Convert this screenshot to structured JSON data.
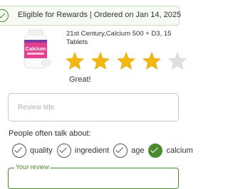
{
  "banner": {
    "text": "Eligible for Rewards | Ordered on Jan 14, 2025",
    "icon": "check-circle-icon",
    "accent_color": "#4a8a2e"
  },
  "product": {
    "name_line1": "21st Century,Calcium 500 + D3, 15 mcg (600",
    "name_line2": "Tablets",
    "label_text": "Calcium"
  },
  "rating": {
    "stars": 4,
    "label": "Great!",
    "star_color": "#f5b80f"
  },
  "form": {
    "review_title_placeholder": "Review title",
    "often_talk_label": "People often talk about:",
    "your_review_label": "Your review"
  },
  "topics": [
    {
      "label": "quality",
      "selected": false
    },
    {
      "label": "ingredient",
      "selected": false
    },
    {
      "label": "age",
      "selected": false
    },
    {
      "label": "calcium",
      "selected": true
    }
  ]
}
